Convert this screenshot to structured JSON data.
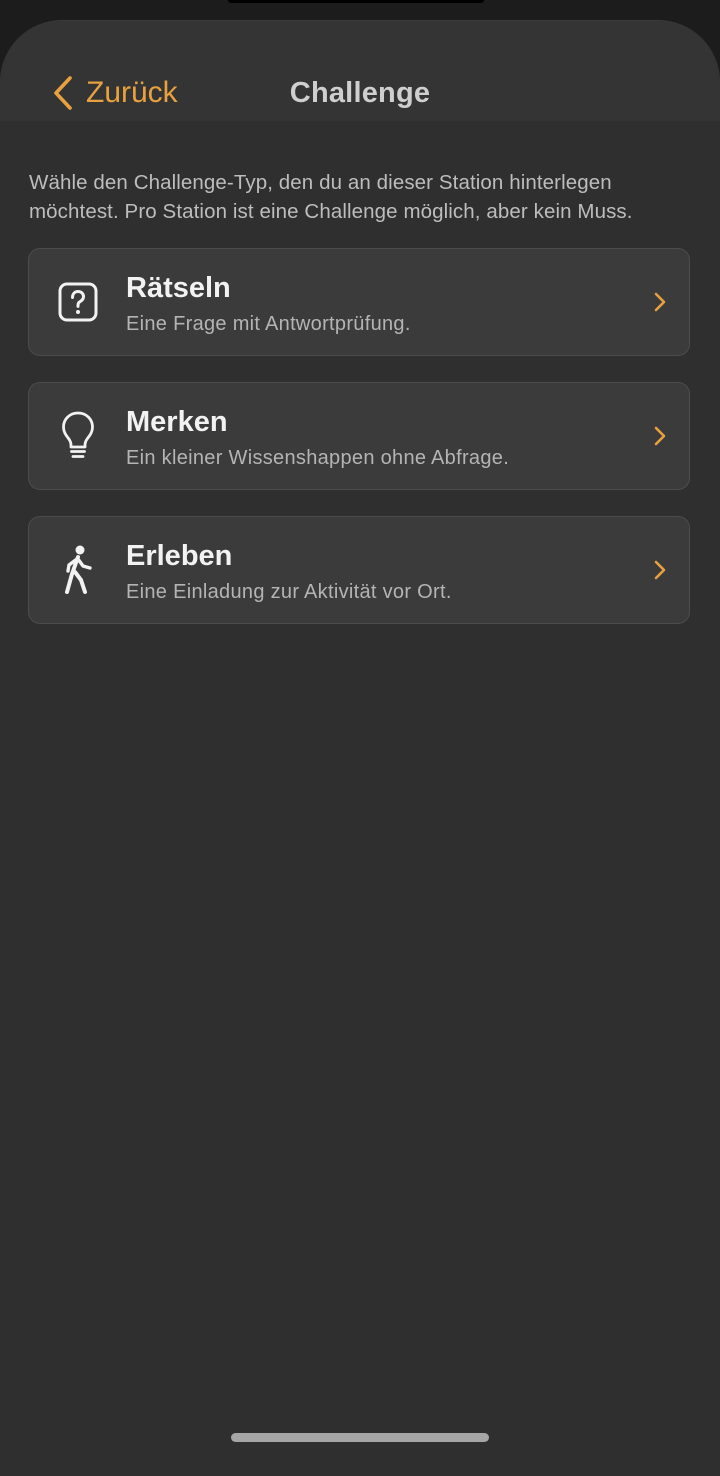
{
  "nav": {
    "back_label": "Zurück",
    "title": "Challenge"
  },
  "intro": "Wähle den Challenge-Typ, den du an dieser Station hinterlegen möchtest. Pro Station ist eine Challenge möglich, aber kein Muss.",
  "options": [
    {
      "title": "Rätseln",
      "subtitle": "Eine Frage mit Antwortprüfung.",
      "icon": "question-mark-square-icon"
    },
    {
      "title": "Merken",
      "subtitle": "Ein kleiner Wissenshappen ohne Abfrage.",
      "icon": "lightbulb-icon"
    },
    {
      "title": "Erleben",
      "subtitle": "Eine Einladung zur Aktivität vor Ort.",
      "icon": "walking-person-icon"
    }
  ],
  "colors": {
    "accent": "#e8a13f",
    "background": "#2f2f2f",
    "card": "#3b3b3b"
  }
}
